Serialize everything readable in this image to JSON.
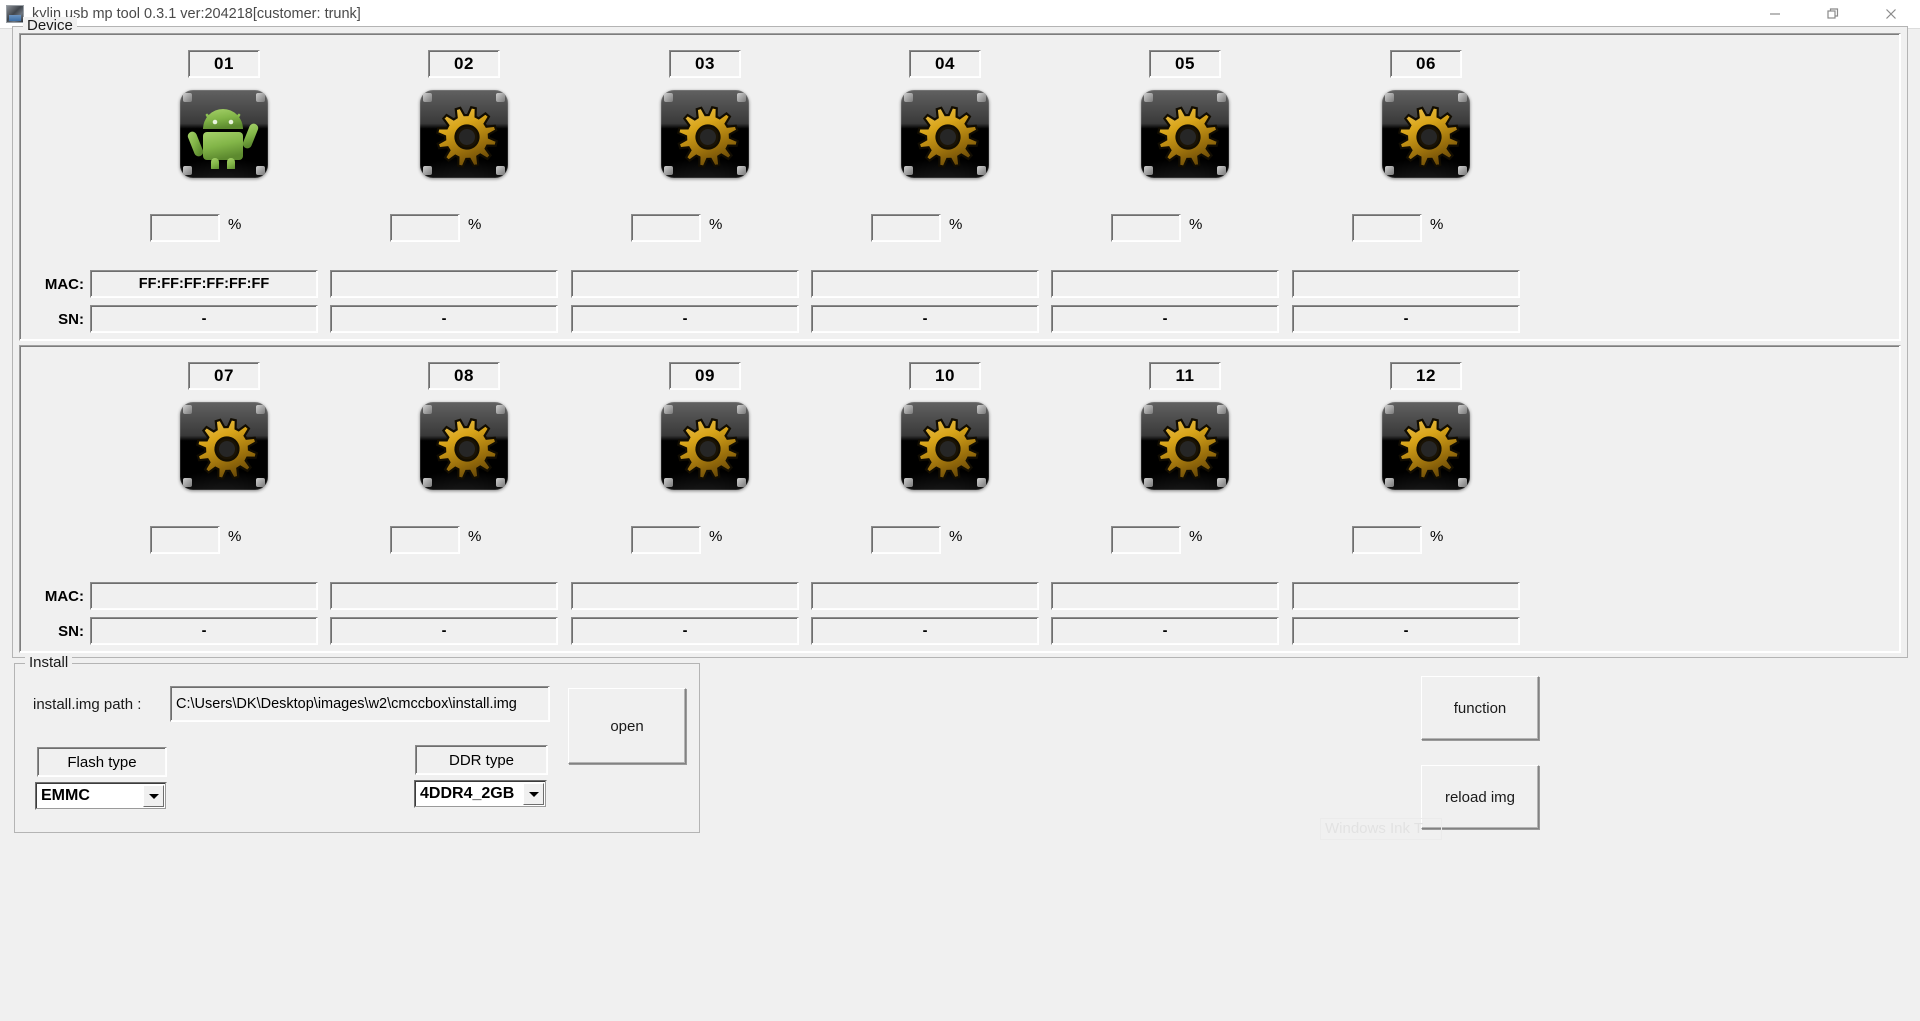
{
  "window": {
    "title": "kylin usb mp tool 0.3.1 ver:204218[customer: trunk]",
    "icon": "app-icon",
    "controls": {
      "minimize": "minimize-icon",
      "restore": "restore-icon",
      "close": "close-icon"
    }
  },
  "device": {
    "legend": "Device",
    "mac_label": "MAC:",
    "sn_label": "SN:",
    "percent_sign": "%",
    "rows": [
      {
        "slots": [
          {
            "num": "01",
            "icon": "android-icon",
            "percent": "",
            "mac": "FF:FF:FF:FF:FF:FF",
            "sn": "-"
          },
          {
            "num": "02",
            "icon": "gear-icon",
            "percent": "",
            "mac": "",
            "sn": "-"
          },
          {
            "num": "03",
            "icon": "gear-icon",
            "percent": "",
            "mac": "",
            "sn": "-"
          },
          {
            "num": "04",
            "icon": "gear-icon",
            "percent": "",
            "mac": "",
            "sn": "-"
          },
          {
            "num": "05",
            "icon": "gear-icon",
            "percent": "",
            "mac": "",
            "sn": "-"
          },
          {
            "num": "06",
            "icon": "gear-icon",
            "percent": "",
            "mac": "",
            "sn": "-"
          }
        ]
      },
      {
        "slots": [
          {
            "num": "07",
            "icon": "gear-icon",
            "percent": "",
            "mac": "",
            "sn": "-"
          },
          {
            "num": "08",
            "icon": "gear-icon",
            "percent": "",
            "mac": "",
            "sn": "-"
          },
          {
            "num": "09",
            "icon": "gear-icon",
            "percent": "",
            "mac": "",
            "sn": "-"
          },
          {
            "num": "10",
            "icon": "gear-icon",
            "percent": "",
            "mac": "",
            "sn": "-"
          },
          {
            "num": "11",
            "icon": "gear-icon",
            "percent": "",
            "mac": "",
            "sn": "-"
          },
          {
            "num": "12",
            "icon": "gear-icon",
            "percent": "",
            "mac": "",
            "sn": "-"
          }
        ]
      }
    ]
  },
  "install": {
    "legend": "Install",
    "path_label": "install.img path :",
    "path_value": "C:\\Users\\DK\\Desktop\\images\\w2\\cmccbox\\install.img",
    "open_label": "open",
    "flash_type_label": "Flash type",
    "flash_type_value": "EMMC",
    "ddr_type_label": "DDR type",
    "ddr_type_value": "4DDR4_2GB"
  },
  "actions": {
    "function_label": "function",
    "reload_label": "reload img"
  },
  "watermark": {
    "text": "Windows Ink T"
  },
  "colors": {
    "window_bg": "#f0f0f0",
    "titlebar_bg": "#ffffff",
    "border": "#b4b4b4",
    "gear_gold": "#d8a419",
    "android_green": "#8bc34a"
  }
}
